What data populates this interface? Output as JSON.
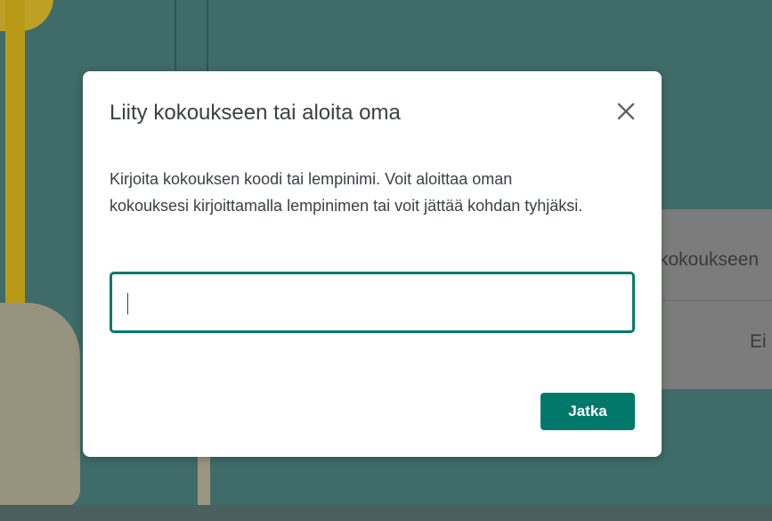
{
  "background_card": {
    "title": "kokoukseen",
    "option": "Ei"
  },
  "dialog": {
    "title": "Liity kokoukseen tai aloita oma",
    "description": "Kirjoita kokouksen koodi tai lempinimi. Voit aloittaa oman kokouksesi kirjoittamalla lempinimen tai voit jättää kohdan tyhjäksi.",
    "input": {
      "value": "",
      "placeholder": ""
    },
    "continue_label": "Jatka",
    "close_icon": "close-icon"
  },
  "colors": {
    "accent": "#00796b",
    "dialog_bg": "#ffffff",
    "text": "#3c4043",
    "overlay_bg": "#3f6b68"
  }
}
